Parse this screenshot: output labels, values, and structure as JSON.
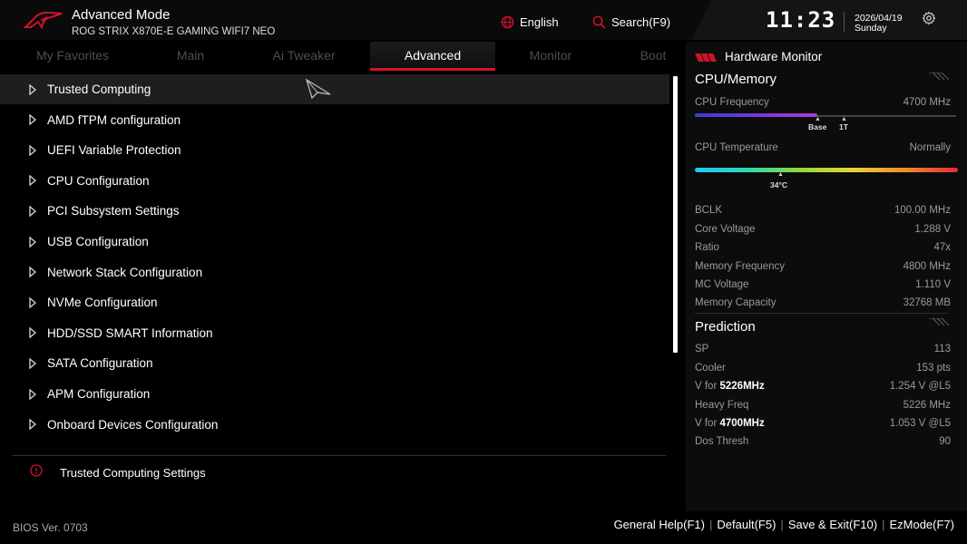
{
  "header": {
    "title": "Advanced Mode",
    "board": "ROG STRIX X870E-E GAMING WIFI7 NEO",
    "language": "English",
    "search": "Search(F9)",
    "time": "11:23",
    "date": "2026/04/19",
    "day": "Sunday"
  },
  "tabs": [
    "My Favorites",
    "Main",
    "Ai Tweaker",
    "Advanced",
    "Monitor",
    "Boot"
  ],
  "active_tab": "Advanced",
  "menu": [
    "Trusted Computing",
    "AMD fTPM configuration",
    "UEFI Variable Protection",
    "CPU Configuration",
    "PCI Subsystem Settings",
    "USB Configuration",
    "Network Stack Configuration",
    "NVMe Configuration",
    "HDD/SSD SMART Information",
    "SATA Configuration",
    "APM Configuration",
    "Onboard Devices Configuration"
  ],
  "selected_item": "Trusted Computing",
  "help_text": "Trusted Computing Settings",
  "bios_version": "BIOS Ver. 0703",
  "footer": [
    "General Help(F1)",
    "Default(F5)",
    "Save & Exit(F10)",
    "EzMode(F7)"
  ],
  "hardware_monitor": {
    "title": "Hardware Monitor",
    "cpu_memory": {
      "title": "CPU/Memory",
      "cpu_frequency_label": "CPU Frequency",
      "cpu_frequency": "4700 MHz",
      "freq_fill_fraction": 0.47,
      "freq_markers": [
        "Base",
        "1T"
      ],
      "cpu_temperature_label": "CPU Temperature",
      "cpu_temperature_status": "Normally",
      "cpu_temperature": "34°C",
      "rows": [
        {
          "label": "BCLK",
          "value": "100.00 MHz"
        },
        {
          "label": "Core Voltage",
          "value": "1.288 V"
        },
        {
          "label": "Ratio",
          "value": "47x"
        },
        {
          "label": "Memory Frequency",
          "value": "4800 MHz"
        },
        {
          "label": "MC Voltage",
          "value": "1.110 V"
        },
        {
          "label": "Memory Capacity",
          "value": "32768 MB"
        }
      ]
    },
    "prediction": {
      "title": "Prediction",
      "rows": [
        {
          "label": "SP",
          "value": "113"
        },
        {
          "label": "Cooler",
          "value": "153 pts"
        },
        {
          "label_prefix": "V for ",
          "label_bold": "5226MHz",
          "value": "1.254 V @L5"
        },
        {
          "label": "Heavy Freq",
          "value": "5226 MHz"
        },
        {
          "label_prefix": "V for ",
          "label_bold": "4700MHz",
          "value": "1.053 V @L5"
        },
        {
          "label": "Dos Thresh",
          "value": "90"
        }
      ]
    }
  },
  "colors": {
    "accent": "#d3122a",
    "inactive_tab": "#4e4e4e"
  }
}
